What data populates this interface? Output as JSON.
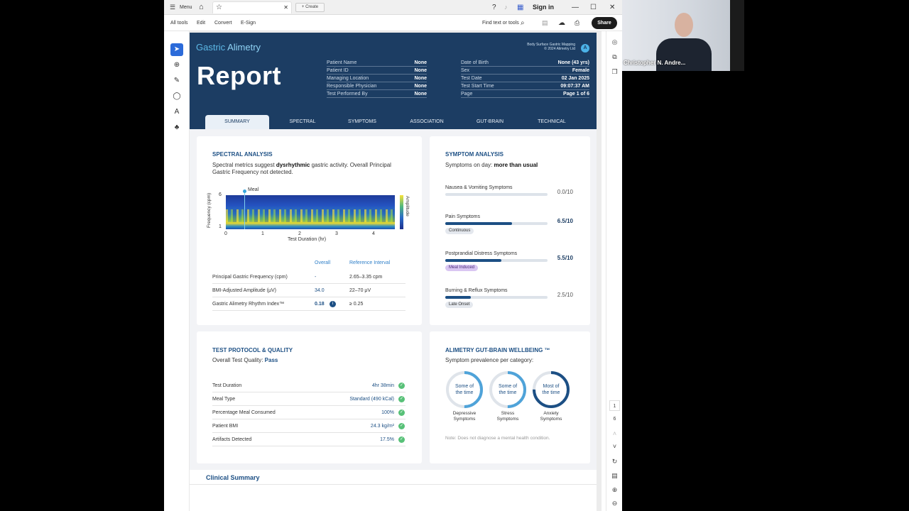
{
  "titlebar": {
    "menu_label": "Menu",
    "create_label": "Create",
    "sign_in_label": "Sign in"
  },
  "toolbar": {
    "items": [
      "All tools",
      "Edit",
      "Convert",
      "E-Sign"
    ],
    "find_label": "Find text or tools",
    "share_label": "Share"
  },
  "report": {
    "brand_part1": "Gastric ",
    "brand_part2": "Alimetry",
    "title": "Report",
    "bsgm_line1": "Body Surface Gastric Mapping",
    "bsgm_line2": "© 2024 Alimetry Ltd",
    "logo_letter": "A",
    "patient_info_left": [
      {
        "label": "Patient Name",
        "value": "None"
      },
      {
        "label": "Patient ID",
        "value": "None"
      },
      {
        "label": "Managing Location",
        "value": "None"
      },
      {
        "label": "Responsible Physician",
        "value": "None"
      },
      {
        "label": "Test Performed By",
        "value": "None"
      }
    ],
    "patient_info_right": [
      {
        "label": "Date of Birth",
        "value": "None (43 yrs)"
      },
      {
        "label": "Sex",
        "value": "Female"
      },
      {
        "label": "Test Date",
        "value": "02 Jan 2025"
      },
      {
        "label": "Test Start Time",
        "value": "09:07:37 AM"
      },
      {
        "label": "Page",
        "value": "Page 1 of 6"
      }
    ],
    "tabs": [
      "SUMMARY",
      "SPECTRAL",
      "SYMPTOMS",
      "ASSOCIATION",
      "GUT-BRAIN",
      "TECHNICAL"
    ],
    "active_tab": 0
  },
  "spectral": {
    "title": "SPECTRAL ANALYSIS",
    "desc_prefix": "Spectral metrics suggest ",
    "desc_bold": "dysrhythmic",
    "desc_suffix": " gastric activity. Overall Principal Gastric Frequency not detected.",
    "meal_label": "Meal",
    "y_axis_label": "Frequency (cpm)",
    "y_ticks": [
      "6",
      "1"
    ],
    "x_ticks": [
      "0",
      "1",
      "2",
      "3",
      "4"
    ],
    "x_axis_label": "Test Duration (hr)",
    "colorbar_label": "Amplitude",
    "col_overall": "Overall",
    "col_reference": "Reference Interval",
    "metrics": [
      {
        "name": "Principal Gastric Frequency (cpm)",
        "overall": "-",
        "reference": "2.65–3.35 cpm"
      },
      {
        "name": "BMI-Adjusted Amplitude (μV)",
        "overall": "34.0",
        "reference": "22–70 μV"
      },
      {
        "name": "Gastric Alimetry Rhythm Index™",
        "overall": "0.18",
        "reference": "≥ 0.25"
      }
    ],
    "info_icon": "i"
  },
  "symptoms": {
    "title": "SYMPTOM ANALYSIS",
    "desc_prefix": "Symptoms on day: ",
    "desc_bold": "more than usual",
    "items": [
      {
        "name": "Nausea & Vomiting Symptoms",
        "score": "0.0/10",
        "value": 0.0,
        "chip": ""
      },
      {
        "name": "Pain Symptoms",
        "score": "6.5/10",
        "value": 6.5,
        "chip": "Continuous"
      },
      {
        "name": "Postprandial Distress Symptoms",
        "score": "5.5/10",
        "value": 5.5,
        "chip": "Meal Induced"
      },
      {
        "name": "Burning & Reflux Symptoms",
        "score": "2.5/10",
        "value": 2.5,
        "chip": "Late Onset"
      }
    ]
  },
  "protocol": {
    "title": "TEST PROTOCOL & QUALITY",
    "quality_prefix": "Overall Test Quality: ",
    "quality_value": "Pass",
    "rows": [
      {
        "label": "Test Duration",
        "value": "4hr 38min"
      },
      {
        "label": "Meal Type",
        "value": "Standard (490 kCal)"
      },
      {
        "label": "Percentage Meal Consumed",
        "value": "100%"
      },
      {
        "label": "Patient BMI",
        "value": "24.3 kg/m²"
      },
      {
        "label": "Artifacts Detected",
        "value": "17.5%"
      }
    ],
    "check_glyph": "✓"
  },
  "gutbrain": {
    "title": "ALIMETRY GUT-BRAIN WELLBEING ™",
    "desc": "Symptom prevalence per category:",
    "gauges": [
      {
        "line1": "Some of",
        "line2": "the time",
        "label1": "Depressive",
        "label2": "Symptoms",
        "level": 0.5
      },
      {
        "line1": "Some of",
        "line2": "the time",
        "label1": "Stress",
        "label2": "Symptoms",
        "level": 0.5
      },
      {
        "line1": "Most of",
        "line2": "the time",
        "label1": "Anxiety",
        "label2": "Symptoms",
        "level": 0.75
      }
    ],
    "note": "Note: Does not diagnose a mental health condition."
  },
  "clinical_summary": {
    "title": "Clinical Summary"
  },
  "page_nav": {
    "current": "1",
    "total": "6"
  },
  "webcam": {
    "name": "Christopher N. Andre..."
  },
  "colors": {
    "navy": "#1c3d63",
    "accent_blue": "#1c4f84",
    "brand_light": "#5cb8e6",
    "pass_green": "#58c178"
  }
}
